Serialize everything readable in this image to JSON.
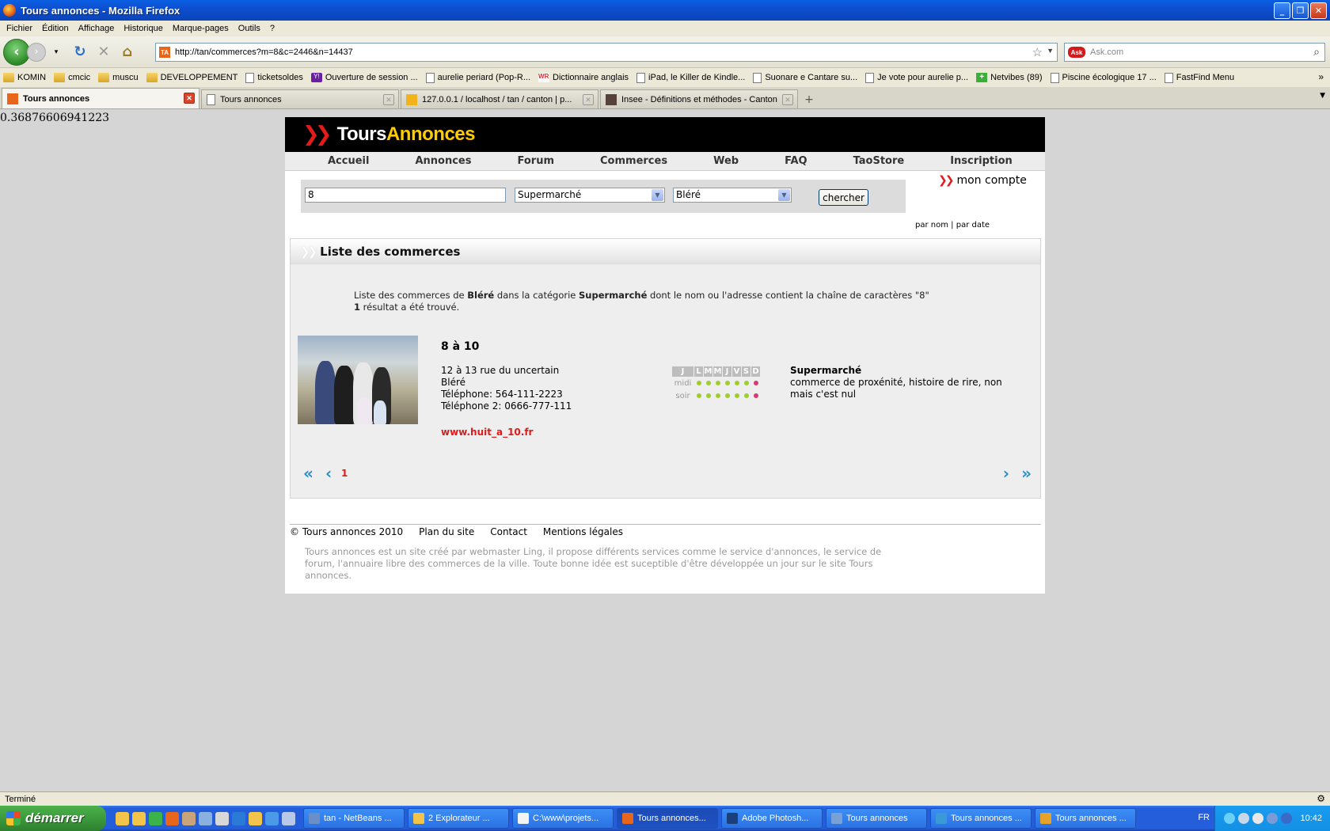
{
  "window": {
    "title": "Tours annonces - Mozilla Firefox"
  },
  "menu": {
    "items": [
      "Fichier",
      "Édition",
      "Affichage",
      "Historique",
      "Marque-pages",
      "Outils",
      "?"
    ]
  },
  "navbar": {
    "url": "http://tan/commerces?m=8&c=2446&n=14437",
    "search_placeholder": "Ask.com"
  },
  "bookmarks": [
    {
      "label": "KOMIN",
      "icon": "folder-icon"
    },
    {
      "label": "cmcic",
      "icon": "folder-icon"
    },
    {
      "label": "muscu",
      "icon": "folder-icon"
    },
    {
      "label": "DEVELOPPEMENT",
      "icon": "folder-icon"
    },
    {
      "label": "ticketsoldes",
      "icon": "page-icon"
    },
    {
      "label": "Ouverture de session ...",
      "icon": "yahoo-icon"
    },
    {
      "label": "aurelie periard (Pop-R...",
      "icon": "page-icon"
    },
    {
      "label": "Dictionnaire anglais",
      "icon": "wordreference-icon"
    },
    {
      "label": "iPad, le Killer de Kindle...",
      "icon": "page-icon"
    },
    {
      "label": "Suonare e Cantare su...",
      "icon": "page-icon"
    },
    {
      "label": "Je vote pour aurelie p...",
      "icon": "page-icon"
    },
    {
      "label": "Netvibes (89)",
      "icon": "netvibes-icon"
    },
    {
      "label": "Piscine écologique 17 ...",
      "icon": "page-icon"
    },
    {
      "label": "FastFind Menu",
      "icon": "page-icon"
    }
  ],
  "tabs": [
    {
      "label": "Tours annonces",
      "active": true
    },
    {
      "label": "Tours annonces",
      "active": false
    },
    {
      "label": "127.0.0.1 / localhost / tan / canton | p...",
      "active": false
    },
    {
      "label": "Insee - Définitions et méthodes - Canton",
      "active": false
    }
  ],
  "page": {
    "random_number": "0.36876606941223",
    "logo": {
      "part1": "Tours",
      "part2": "Annonces"
    },
    "nav": [
      "Accueil",
      "Annonces",
      "Forum",
      "Commerces",
      "Web",
      "FAQ",
      "TaoStore",
      "Inscription"
    ],
    "search": {
      "query": "8",
      "category": "Supermarché",
      "city": "Bléré",
      "button": "chercher"
    },
    "account_link": "mon compte",
    "sort": {
      "by_name": "par nom",
      "sep": "|",
      "by_date": "par date"
    },
    "list_title": "Liste des commerces",
    "summary": {
      "prefix": "Liste des commerces de ",
      "city": "Bléré",
      "mid": " dans la catégorie ",
      "category": "Supermarché",
      "suffix": " dont le nom ou l'adresse contient la chaîne de caractères \"8\"",
      "count": "1",
      "count_text": " résultat a été trouvé."
    },
    "result": {
      "name": "8 à 10",
      "address": "12 à 13 rue du uncertain",
      "city": "Bléré",
      "phone": "Téléphone: 564-111-2223",
      "phone2": "Téléphone 2: 0666-777-111",
      "website": "www.huit_a_10.fr",
      "category": "Supermarché",
      "description": "commerce de proxénité, histoire de rire, non mais c'est nul",
      "hours": {
        "head": [
          "J",
          "L",
          "M",
          "M",
          "J",
          "V",
          "S",
          "D"
        ],
        "midi_label": "midi",
        "soir_label": "soir",
        "midi": [
          "open",
          "open",
          "open",
          "open",
          "open",
          "open",
          "closed"
        ],
        "soir": [
          "open",
          "open",
          "open",
          "open",
          "open",
          "open",
          "closed"
        ],
        "colors": {
          "open": "#9fcc2e",
          "closed": "#d83a6e"
        }
      }
    },
    "pager": {
      "first": "«",
      "prev": "‹",
      "current": "1",
      "next": "›",
      "last": "»"
    },
    "footer": {
      "copyright": "© Tours annonces 2010",
      "links": [
        "Plan du site",
        "Contact",
        "Mentions légales"
      ],
      "text": "Tours annonces est un site créé par webmaster Ling, il propose différents services comme le service d'annonces, le service de forum, l'annuaire libre des commerces de la ville. Toute bonne idée est suceptible d'être développée un jour sur le site Tours annonces."
    }
  },
  "status": {
    "text": "Terminé"
  },
  "taskbar": {
    "start": "démarrer",
    "tasks": [
      {
        "label": "tan - NetBeans ...",
        "color": "#6a8fc8"
      },
      {
        "label": "2 Explorateur ...",
        "color": "#f2c44a"
      },
      {
        "label": "C:\\www\\projets...",
        "color": "#f3f3f3"
      },
      {
        "label": "Tours annonces...",
        "color": "#e8661c",
        "active": true
      },
      {
        "label": "Adobe Photosh...",
        "color": "#1b3f7a"
      },
      {
        "label": "Tours annonces",
        "color": "#7aa0d8"
      },
      {
        "label": "Tours annonces ...",
        "color": "#3a9ad8"
      },
      {
        "label": "Tours annonces ...",
        "color": "#e5a32a"
      }
    ],
    "lang": "FR",
    "clock": "10:42"
  }
}
